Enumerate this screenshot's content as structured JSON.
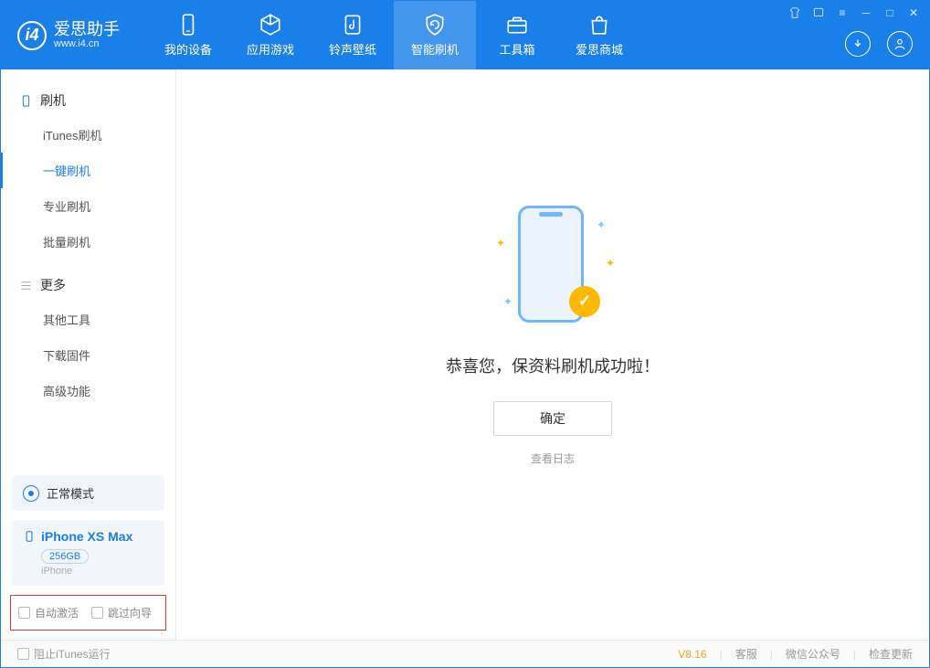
{
  "app": {
    "name": "爱思助手",
    "url": "www.i4.cn"
  },
  "titlebar_icons": [
    "shirt",
    "scan",
    "menu",
    "min",
    "max",
    "close"
  ],
  "nav": [
    {
      "key": "device",
      "label": "我的设备"
    },
    {
      "key": "apps",
      "label": "应用游戏"
    },
    {
      "key": "ringtone",
      "label": "铃声壁纸"
    },
    {
      "key": "flash",
      "label": "智能刷机",
      "active": true
    },
    {
      "key": "toolbox",
      "label": "工具箱"
    },
    {
      "key": "store",
      "label": "爱思商城"
    }
  ],
  "sidebar": {
    "section1": {
      "title": "刷机",
      "items": [
        "iTunes刷机",
        "一键刷机",
        "专业刷机",
        "批量刷机"
      ],
      "activeIndex": 1
    },
    "section2": {
      "title": "更多",
      "items": [
        "其他工具",
        "下载固件",
        "高级功能"
      ]
    }
  },
  "mode": {
    "label": "正常模式"
  },
  "device": {
    "name": "iPhone XS Max",
    "storage": "256GB",
    "type": "iPhone"
  },
  "checkboxes": {
    "autoActivate": "自动激活",
    "skipGuide": "跳过向导"
  },
  "main": {
    "successMsg": "恭喜您，保资料刷机成功啦！",
    "confirmBtn": "确定",
    "viewLog": "查看日志"
  },
  "footer": {
    "blockItunes": "阻止iTunes运行",
    "version": "V8.16",
    "links": [
      "客服",
      "微信公众号",
      "检查更新"
    ]
  }
}
